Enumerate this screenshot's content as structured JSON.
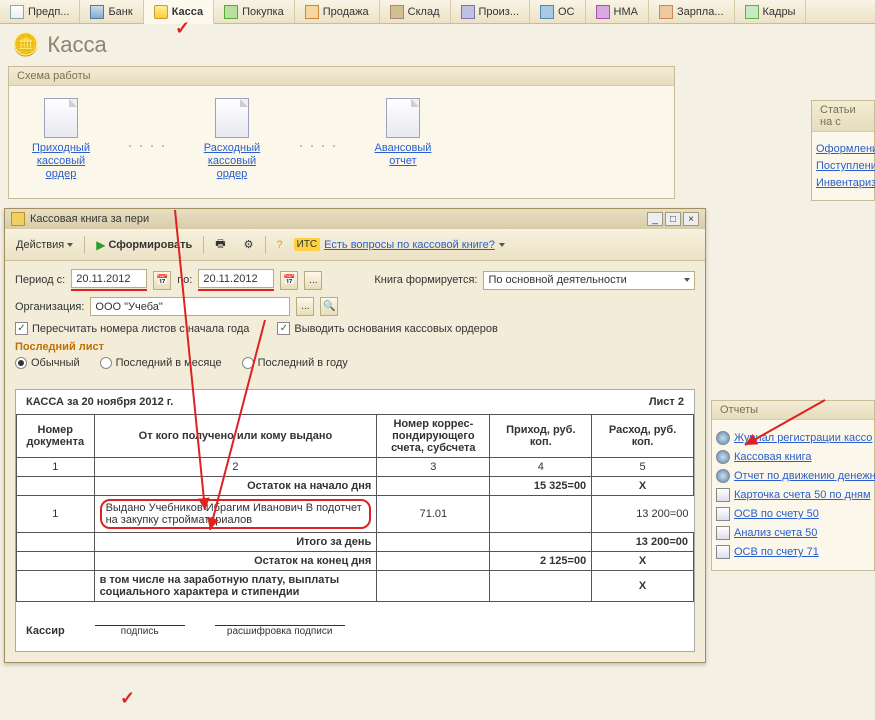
{
  "tabs": [
    {
      "label": "Предп..."
    },
    {
      "label": "Банк"
    },
    {
      "label": "Касса"
    },
    {
      "label": "Покупка"
    },
    {
      "label": "Продажа"
    },
    {
      "label": "Склад"
    },
    {
      "label": "Произ..."
    },
    {
      "label": "ОС"
    },
    {
      "label": "НМА"
    },
    {
      "label": "Зарпла..."
    },
    {
      "label": "Кадры"
    }
  ],
  "page_title": "Касса",
  "scheme": {
    "title": "Схема работы",
    "items": [
      "Приходный кассовый ордер",
      "Расходный кассовый ордер",
      "Авансовый отчет"
    ]
  },
  "side_top": {
    "title": "Статьи на с",
    "links": [
      "Оформление ордера",
      "Поступление",
      "Инвентаризац организации"
    ]
  },
  "window": {
    "title": "Кассовая книга за пери",
    "toolbar": {
      "actions": "Действия",
      "form": "Сформировать",
      "faq": "Есть вопросы по кассовой книге?",
      "its": "ИТС"
    },
    "period_label": "Период с:",
    "date_from": "20.11.2012",
    "to_label": "по:",
    "date_to": "20.11.2012",
    "book_label": "Книга формируется:",
    "book_val": "По основной деятельности",
    "org_label": "Организация:",
    "org_val": "ООО \"Учеба\"",
    "chk1": "Пересчитать номера листов с начала года",
    "chk2": "Выводить основания кассовых ордеров",
    "last_sheet": "Последний лист",
    "r1": "Обычный",
    "r2": "Последний в месяце",
    "r3": "Последний в году"
  },
  "report": {
    "header_left": "КАССА за 20 ноября 2012 г.",
    "header_right": "Лист 2",
    "cols": [
      "Номер документа",
      "От кого получено или кому выдано",
      "Номер коррес-пондирующего счета, субсчета",
      "Приход, руб. коп.",
      "Расход, руб. коп."
    ],
    "nums": [
      "1",
      "2",
      "3",
      "4",
      "5"
    ],
    "start_label": "Остаток на начало дня",
    "start_val": "15 325=00",
    "x": "Х",
    "row1": {
      "num": "1",
      "text": "Выдано Учебников Ибрагим Иванович В подотчет на закупку стройматериалов",
      "acc": "71.01",
      "out": "13 200=00"
    },
    "day_total": "Итого за день",
    "end_label": "Остаток на конец дня",
    "end_val": "2 125=00",
    "incl": "в том числе на заработную плату, выплаты социального характера и стипендии",
    "cashier": "Кассир",
    "sig_lbl": "подпись",
    "sig_name": "расшифровка подписи"
  },
  "reports_panel": {
    "title": "Отчеты",
    "links": [
      "Журнал регистрации кассо",
      "Кассовая книга",
      "Отчет по движению денежн",
      "Карточка счета 50 по дням",
      "ОСВ по счету 50",
      "Анализ счета 50",
      "ОСВ по счету 71"
    ]
  }
}
